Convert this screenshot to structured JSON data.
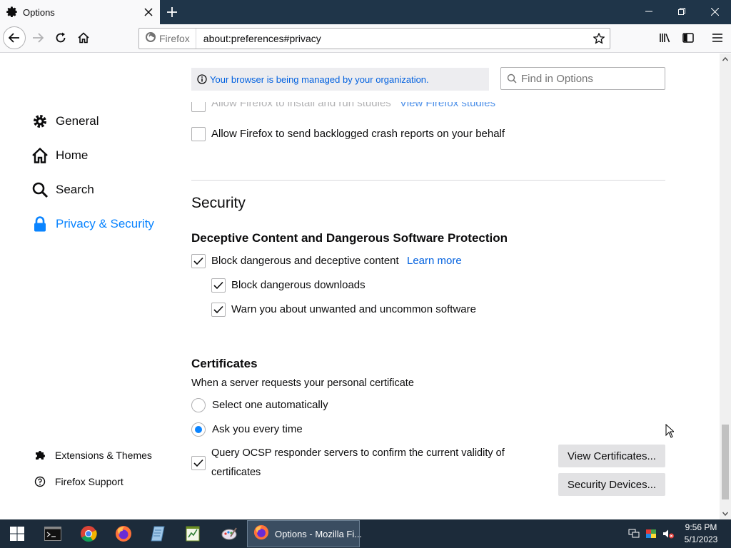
{
  "window": {
    "tab_title": "Options",
    "tab_icon": "gear-icon"
  },
  "navbar": {
    "identity_label": "Firefox",
    "url": "about:preferences#privacy"
  },
  "sidebar": {
    "items": [
      {
        "label": "General",
        "icon": "gear-icon"
      },
      {
        "label": "Home",
        "icon": "home-icon"
      },
      {
        "label": "Search",
        "icon": "search-icon"
      },
      {
        "label": "Privacy & Security",
        "icon": "lock-icon",
        "active": true
      }
    ],
    "footer": [
      {
        "label": "Extensions & Themes",
        "icon": "puzzle-icon"
      },
      {
        "label": "Firefox Support",
        "icon": "help-icon"
      }
    ]
  },
  "policy_banner": "Your browser is being managed by your organization.",
  "find": {
    "placeholder": "Find in Options"
  },
  "data_collection": {
    "studies_label": "Allow Firefox to install and run studies",
    "studies_link": "View Firefox studies",
    "crash_reports_label": "Allow Firefox to send backlogged crash reports on your behalf",
    "crash_reports_checked": false
  },
  "security": {
    "title": "Security",
    "deceptive_heading": "Deceptive Content and Dangerous Software Protection",
    "block_dangerous_label": "Block dangerous and deceptive content",
    "block_dangerous_checked": true,
    "learn_more": "Learn more",
    "block_downloads_label": "Block dangerous downloads",
    "block_downloads_checked": true,
    "warn_unwanted_label": "Warn you about unwanted and uncommon software",
    "warn_unwanted_checked": true
  },
  "certificates": {
    "heading": "Certificates",
    "description": "When a server requests your personal certificate",
    "option_auto": "Select one automatically",
    "option_ask": "Ask you every time",
    "selected": "ask",
    "ocsp_line1": "Query OCSP responder servers to confirm the current validity of",
    "ocsp_line2": "certificates",
    "ocsp_checked": true,
    "view_certs_button": "View Certificates...",
    "security_devices_button": "Security Devices..."
  },
  "taskbar": {
    "active_window_label": "Options - Mozilla Fi...",
    "time": "9:56 PM",
    "date": "5/1/2023"
  },
  "colors": {
    "accent": "#0a84ff",
    "link": "#0060df",
    "titlebar": "#1f3549",
    "taskbar": "#1c2b3a"
  }
}
